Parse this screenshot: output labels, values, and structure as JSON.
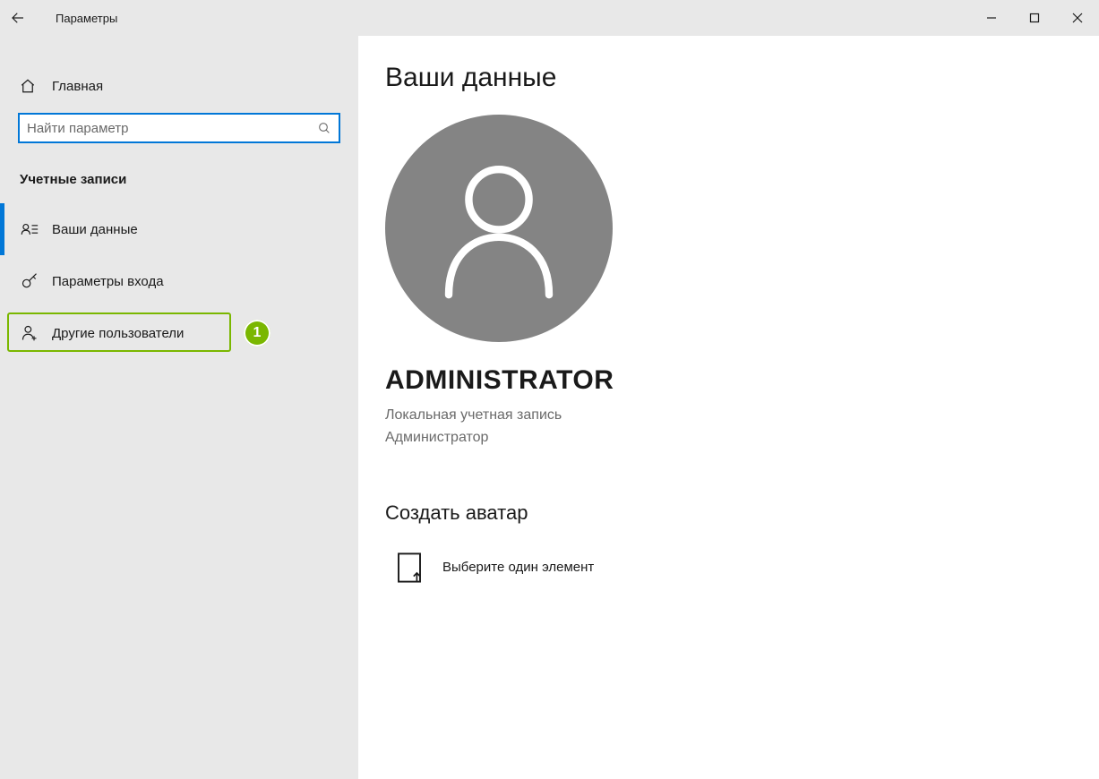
{
  "titlebar": {
    "title": "Параметры"
  },
  "sidebar": {
    "home": "Главная",
    "search_placeholder": "Найти параметр",
    "section": "Учетные записи",
    "items": [
      {
        "label": "Ваши данные"
      },
      {
        "label": "Параметры входа"
      },
      {
        "label": "Другие пользователи"
      }
    ]
  },
  "annotation": {
    "number": "1"
  },
  "main": {
    "heading": "Ваши данные",
    "user_name": "ADMINISTRATOR",
    "user_meta1": "Локальная учетная запись",
    "user_meta2": "Администратор",
    "create_avatar_heading": "Создать аватар",
    "pick_one": "Выберите один элемент"
  }
}
